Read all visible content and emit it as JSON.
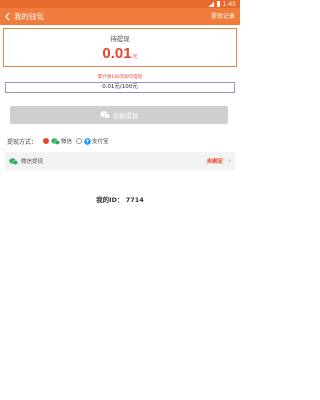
{
  "status_bar": {
    "time": "1:45"
  },
  "header": {
    "back_icon": "back-arrow-icon",
    "title": "我的钱包",
    "right_link": "提现记录"
  },
  "balance_card": {
    "label": "待提现",
    "amount": "0.01",
    "unit": "元"
  },
  "hint": "累计领100元即可提现",
  "progress": {
    "text": "0.01元/100元",
    "fraction": 0.0001
  },
  "withdraw_button": {
    "label": "全额提现",
    "icon": "wechat-icon"
  },
  "payment": {
    "label": "提现方式：",
    "options": [
      {
        "label": "微信",
        "icon": "wechat-icon",
        "selected": true
      },
      {
        "label": "支付宝",
        "icon": "alipay-icon",
        "selected": false
      }
    ]
  },
  "bind_row": {
    "label": "微信提现",
    "status": "未绑定"
  },
  "my_id": "我的ID： 7714",
  "colors": {
    "accent": "#f07b3c",
    "red": "#e8442a",
    "wechat": "#2aae67",
    "alipay": "#1b9bff"
  }
}
